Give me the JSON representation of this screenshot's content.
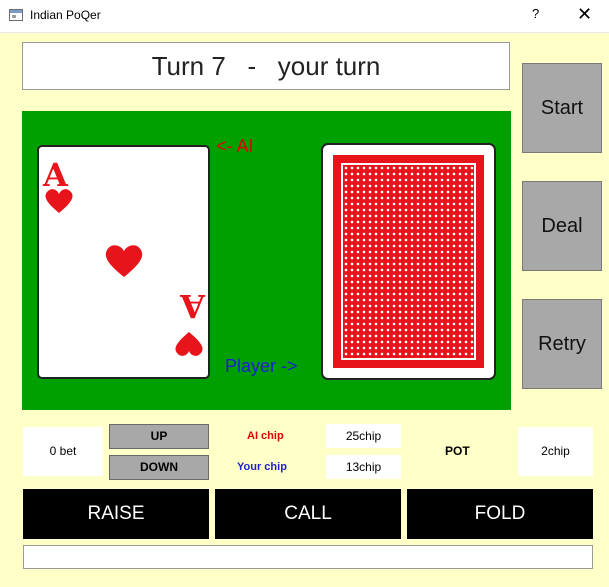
{
  "window": {
    "title": "Indian PoQer",
    "help_label": "?",
    "close_label": "✕"
  },
  "turn": {
    "text": "Turn 7   -   your turn"
  },
  "side_buttons": {
    "start": "Start",
    "deal": "Deal",
    "retry": "Retry"
  },
  "table": {
    "ai_label": "<- AI",
    "player_label": "Player ->",
    "ai_card": {
      "rank": "A",
      "suit": "hearts",
      "color": "#e8141c"
    },
    "player_card": {
      "face": "back",
      "color": "#e8141c"
    }
  },
  "betting": {
    "bet_value": "0 bet",
    "up_label": "UP",
    "down_label": "DOWN",
    "ai_chip_label": "AI chip",
    "ai_chip_value": "25chip",
    "your_chip_label": "Your chip",
    "your_chip_value": "13chip",
    "pot_label": "POT",
    "pot_value": "2chip"
  },
  "actions": {
    "raise": "RAISE",
    "call": "CALL",
    "fold": "FOLD"
  },
  "status": {
    "text": ""
  },
  "colors": {
    "background": "#ffffc8",
    "table_green": "#00a000",
    "ai_red": "#e00000",
    "player_blue": "#2020d0",
    "button_gray": "#a8a8a8"
  }
}
